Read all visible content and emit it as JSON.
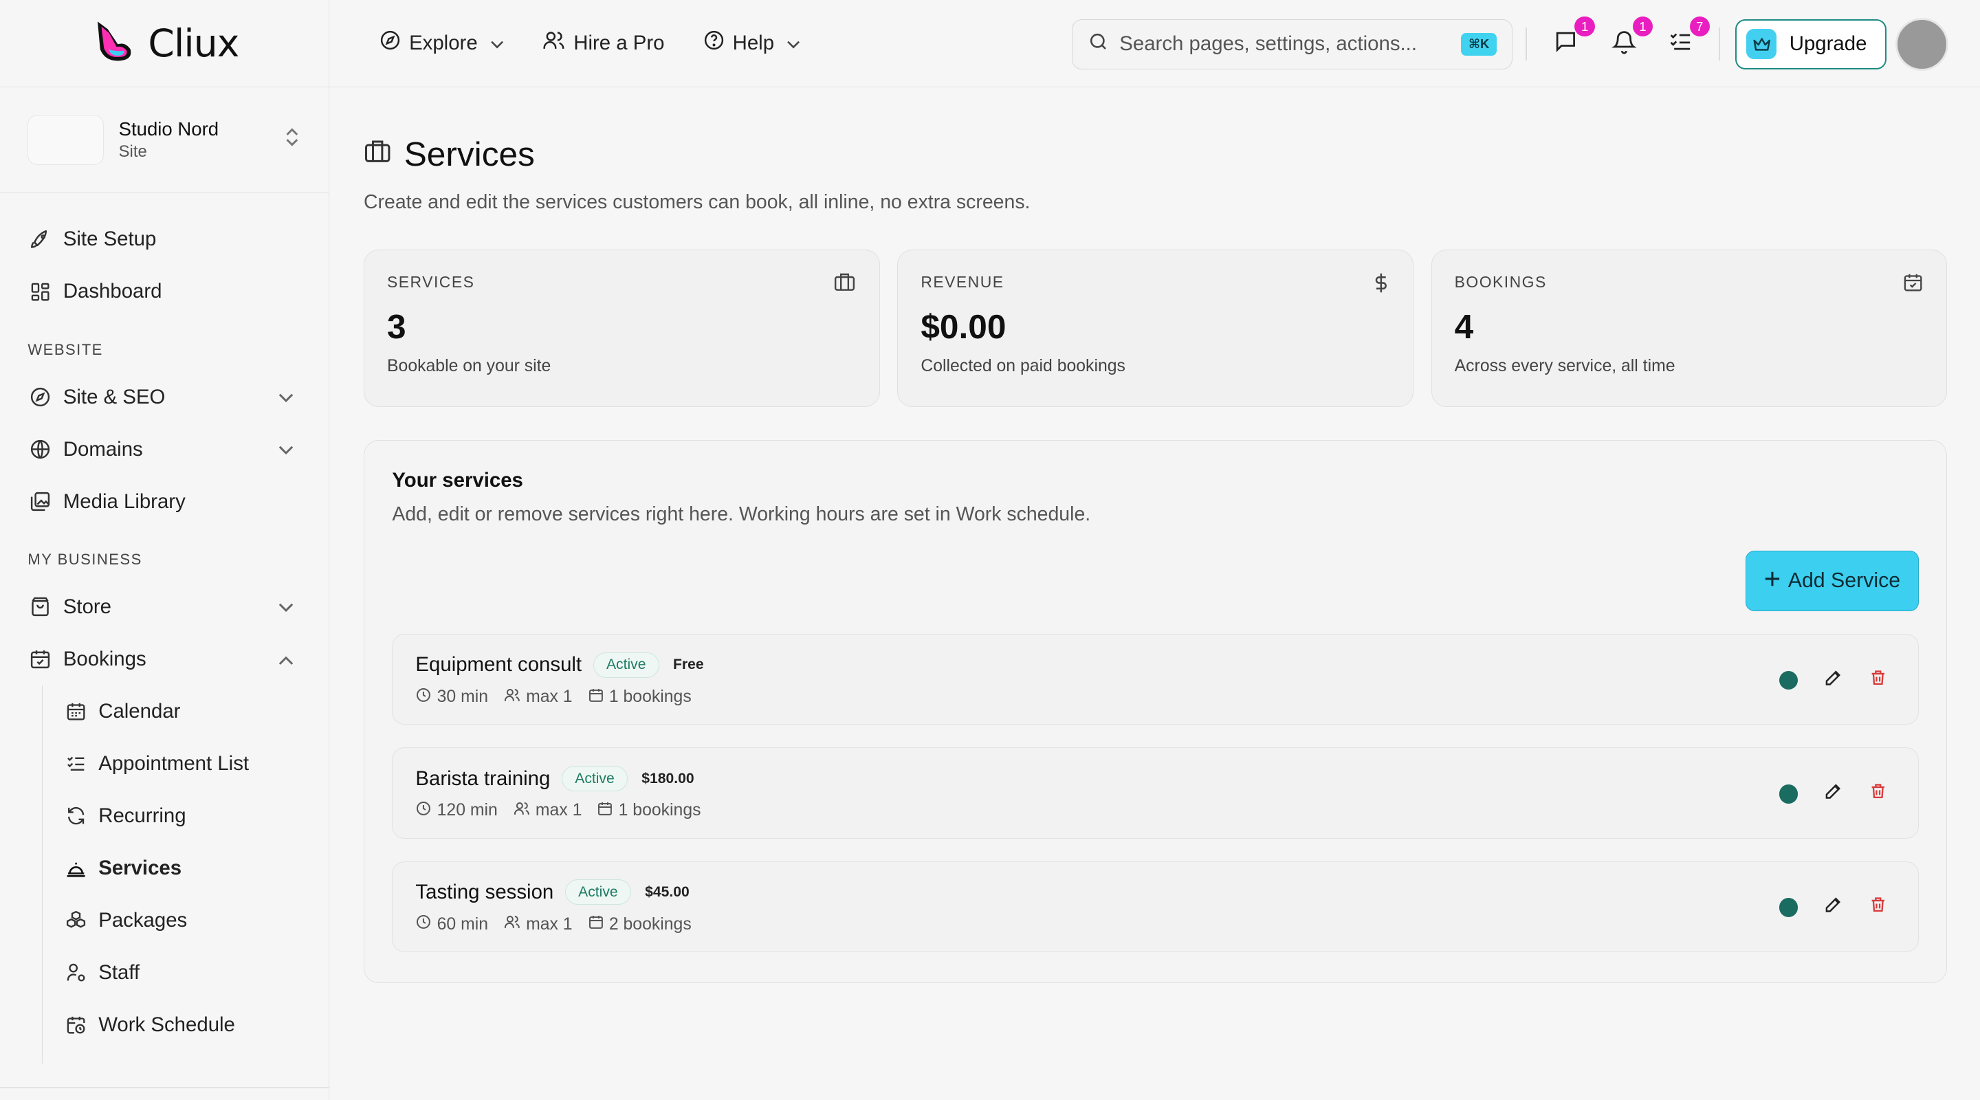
{
  "brand": {
    "name": "Cliux",
    "accent": "#3ccff0",
    "badge_color": "#e91ec0"
  },
  "site": {
    "name": "Studio Nord",
    "type": "Site"
  },
  "sidebar": {
    "top_items": [
      {
        "label": "Site Setup",
        "icon": "rocket-icon"
      },
      {
        "label": "Dashboard",
        "icon": "dashboard-icon"
      }
    ],
    "website_label": "WEBSITE",
    "website_items": [
      {
        "label": "Site & SEO",
        "icon": "compass-icon"
      },
      {
        "label": "Domains",
        "icon": "globe-icon"
      },
      {
        "label": "Media Library",
        "icon": "image-icon"
      }
    ],
    "business_label": "MY BUSINESS",
    "business_items": [
      {
        "label": "Store",
        "icon": "bag-icon"
      },
      {
        "label": "Bookings",
        "icon": "calendar-icon"
      }
    ],
    "booking_sub": [
      {
        "label": "Calendar"
      },
      {
        "label": "Appointment List"
      },
      {
        "label": "Recurring"
      },
      {
        "label": "Services"
      },
      {
        "label": "Packages"
      },
      {
        "label": "Staff"
      },
      {
        "label": "Work Schedule"
      }
    ]
  },
  "topbar": {
    "explore": "Explore",
    "hire": "Hire a Pro",
    "help": "Help",
    "search_placeholder": "Search pages, settings, actions...",
    "shortcut": "⌘K",
    "messages_count": "1",
    "notifications_count": "1",
    "tasks_count": "7",
    "upgrade": "Upgrade"
  },
  "page": {
    "title": "Services",
    "description": "Create and edit the services customers can book, all inline, no extra screens."
  },
  "stats": [
    {
      "label": "SERVICES",
      "value": "3",
      "sub": "Bookable on your site",
      "icon": "briefcase-icon"
    },
    {
      "label": "REVENUE",
      "value": "$0.00",
      "sub": "Collected on paid bookings",
      "icon": "dollar-icon"
    },
    {
      "label": "BOOKINGS",
      "value": "4",
      "sub": "Across every service, all time",
      "icon": "calendar-check-icon"
    }
  ],
  "panel": {
    "title": "Your services",
    "description": "Add, edit or remove services right here. Working hours are set in Work schedule.",
    "add_label": "Add Service"
  },
  "services": [
    {
      "name": "Equipment consult",
      "status": "Active",
      "price": "Free",
      "duration": "30 min",
      "capacity": "max 1",
      "bookings": "1 bookings"
    },
    {
      "name": "Barista training",
      "status": "Active",
      "price": "$180.00",
      "duration": "120 min",
      "capacity": "max 1",
      "bookings": "1 bookings"
    },
    {
      "name": "Tasting session",
      "status": "Active",
      "price": "$45.00",
      "duration": "60 min",
      "capacity": "max 1",
      "bookings": "2 bookings"
    }
  ]
}
